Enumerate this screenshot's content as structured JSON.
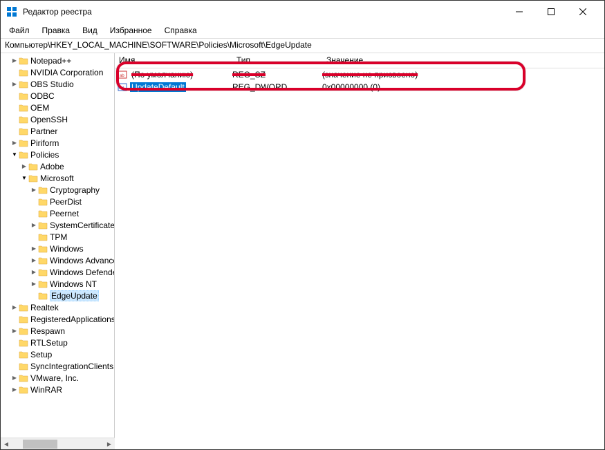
{
  "window": {
    "title": "Редактор реестра"
  },
  "menu": {
    "file": "Файл",
    "edit": "Правка",
    "view": "Вид",
    "favorites": "Избранное",
    "help": "Справка"
  },
  "addressbar": "Компьютер\\HKEY_LOCAL_MACHINE\\SOFTWARE\\Policies\\Microsoft\\EdgeUpdate",
  "columns": {
    "name": "Имя",
    "type": "Тип",
    "value": "Значение"
  },
  "rows": [
    {
      "name": "(По умолчанию)",
      "type": "REG_SZ",
      "value": "(значение не присвоено)",
      "icon": "sz",
      "selected": false,
      "strike": true
    },
    {
      "name": "UpdateDefault",
      "type": "REG_DWORD",
      "value": "0x00000000 (0)",
      "icon": "dword",
      "selected": true,
      "strike": false
    }
  ],
  "tree": [
    {
      "label": "Notepad++",
      "indent": 1,
      "exp": "closed"
    },
    {
      "label": "NVIDIA Corporation",
      "indent": 1,
      "exp": "none"
    },
    {
      "label": "OBS Studio",
      "indent": 1,
      "exp": "closed"
    },
    {
      "label": "ODBC",
      "indent": 1,
      "exp": "none"
    },
    {
      "label": "OEM",
      "indent": 1,
      "exp": "none"
    },
    {
      "label": "OpenSSH",
      "indent": 1,
      "exp": "none"
    },
    {
      "label": "Partner",
      "indent": 1,
      "exp": "none"
    },
    {
      "label": "Piriform",
      "indent": 1,
      "exp": "closed"
    },
    {
      "label": "Policies",
      "indent": 1,
      "exp": "open"
    },
    {
      "label": "Adobe",
      "indent": 2,
      "exp": "closed"
    },
    {
      "label": "Microsoft",
      "indent": 2,
      "exp": "open"
    },
    {
      "label": "Cryptography",
      "indent": 3,
      "exp": "closed"
    },
    {
      "label": "PeerDist",
      "indent": 3,
      "exp": "none"
    },
    {
      "label": "Peernet",
      "indent": 3,
      "exp": "none"
    },
    {
      "label": "SystemCertificates",
      "indent": 3,
      "exp": "closed"
    },
    {
      "label": "TPM",
      "indent": 3,
      "exp": "none"
    },
    {
      "label": "Windows",
      "indent": 3,
      "exp": "closed"
    },
    {
      "label": "Windows Advanced",
      "indent": 3,
      "exp": "closed"
    },
    {
      "label": "Windows Defender",
      "indent": 3,
      "exp": "closed"
    },
    {
      "label": "Windows NT",
      "indent": 3,
      "exp": "closed"
    },
    {
      "label": "EdgeUpdate",
      "indent": 3,
      "exp": "none",
      "selected": true
    },
    {
      "label": "Realtek",
      "indent": 1,
      "exp": "closed"
    },
    {
      "label": "RegisteredApplications",
      "indent": 1,
      "exp": "none"
    },
    {
      "label": "Respawn",
      "indent": 1,
      "exp": "closed"
    },
    {
      "label": "RTLSetup",
      "indent": 1,
      "exp": "none"
    },
    {
      "label": "Setup",
      "indent": 1,
      "exp": "none"
    },
    {
      "label": "SyncIntegrationClients",
      "indent": 1,
      "exp": "none"
    },
    {
      "label": "VMware, Inc.",
      "indent": 1,
      "exp": "closed"
    },
    {
      "label": "WinRAR",
      "indent": 1,
      "exp": "closed"
    }
  ]
}
